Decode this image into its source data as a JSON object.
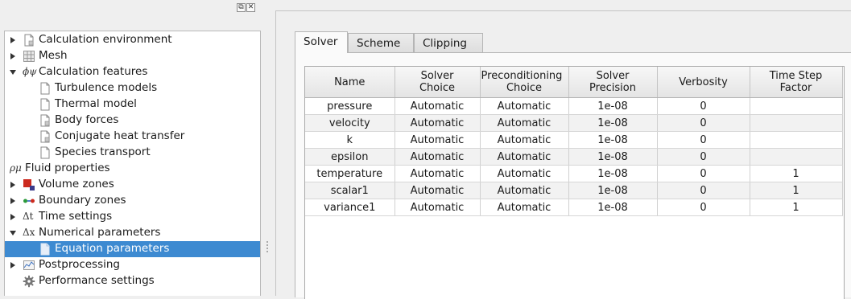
{
  "dock": {
    "float_icon": "float-dock-icon",
    "close_icon": "close-dock-icon",
    "float_glyph": "⧉",
    "close_glyph": "✕"
  },
  "tree": {
    "items": [
      {
        "label": "Calculation environment",
        "icon": "document-icon"
      },
      {
        "label": "Mesh",
        "icon": "grid-icon"
      },
      {
        "label": "Calculation features",
        "icon": "phi-psi-icon",
        "glyph": "ϕψ"
      },
      {
        "label": "Turbulence models",
        "icon": "document-icon"
      },
      {
        "label": "Thermal model",
        "icon": "document-icon"
      },
      {
        "label": "Body forces",
        "icon": "document-icon"
      },
      {
        "label": "Conjugate heat transfer",
        "icon": "document-icon"
      },
      {
        "label": "Species transport",
        "icon": "document-icon"
      },
      {
        "label": "Fluid properties",
        "icon": "rho-mu-icon",
        "glyph": "ρμ"
      },
      {
        "label": "Volume zones",
        "icon": "volume-zones-icon"
      },
      {
        "label": "Boundary zones",
        "icon": "boundary-zones-icon"
      },
      {
        "label": "Time settings",
        "icon": "delta-t-icon",
        "glyph": "Δt"
      },
      {
        "label": "Numerical parameters",
        "icon": "delta-x-icon",
        "glyph": "Δx"
      },
      {
        "label": "Equation parameters",
        "icon": "document-icon"
      },
      {
        "label": "Postprocessing",
        "icon": "chart-icon"
      },
      {
        "label": "Performance settings",
        "icon": "gear-icon"
      }
    ]
  },
  "tabs": [
    {
      "label": "Solver"
    },
    {
      "label": "Scheme"
    },
    {
      "label": "Clipping"
    }
  ],
  "table": {
    "headers": [
      [
        "Name"
      ],
      [
        "Solver",
        "Choice"
      ],
      [
        "Preconditioning",
        "Choice"
      ],
      [
        "Solver",
        "Precision"
      ],
      [
        "Verbosity"
      ],
      [
        "Time Step",
        "Factor"
      ]
    ],
    "rows": [
      [
        "pressure",
        "Automatic",
        "Automatic",
        "1e-08",
        "0",
        ""
      ],
      [
        "velocity",
        "Automatic",
        "Automatic",
        "1e-08",
        "0",
        ""
      ],
      [
        "k",
        "Automatic",
        "Automatic",
        "1e-08",
        "0",
        ""
      ],
      [
        "epsilon",
        "Automatic",
        "Automatic",
        "1e-08",
        "0",
        ""
      ],
      [
        "temperature",
        "Automatic",
        "Automatic",
        "1e-08",
        "0",
        "1"
      ],
      [
        "scalar1",
        "Automatic",
        "Automatic",
        "1e-08",
        "0",
        "1"
      ],
      [
        "variance1",
        "Automatic",
        "Automatic",
        "1e-08",
        "0",
        "1"
      ]
    ]
  },
  "colors": {
    "selection": "#3d8ad1",
    "background": "#efefef"
  }
}
